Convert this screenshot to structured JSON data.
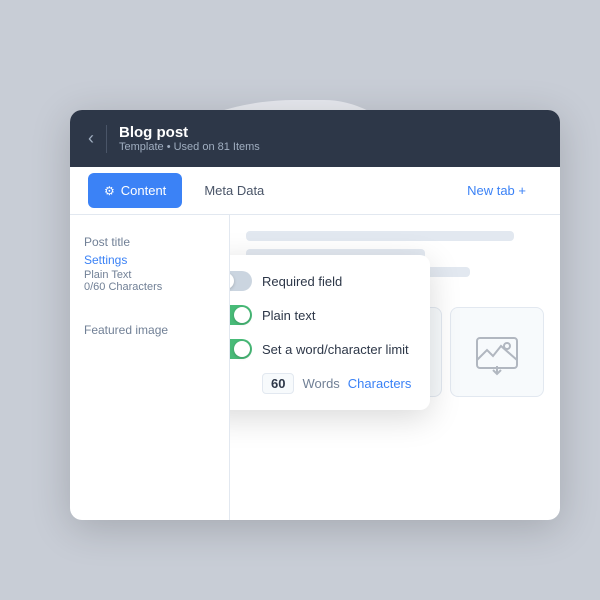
{
  "header": {
    "back_label": "‹",
    "title": "Blog post",
    "subtitle": "Template • Used on 81 Items",
    "divider": true
  },
  "tabs": [
    {
      "id": "content",
      "label": "Content",
      "active": true,
      "icon": "⚙"
    },
    {
      "id": "metadata",
      "label": "Meta Data",
      "active": false
    },
    {
      "id": "newtab",
      "label": "New tab +",
      "active": false
    }
  ],
  "sidebar": {
    "post_title_label": "Post title",
    "settings_link": "Settings",
    "plain_text": "Plain Text",
    "chars_count": "0/60 Characters",
    "featured_image_label": "Featured image"
  },
  "dropdown": {
    "required_field": {
      "label": "Required field",
      "enabled": false
    },
    "plain_text": {
      "label": "Plain text",
      "enabled": true
    },
    "word_limit": {
      "label": "Set a word/character limit",
      "enabled": true
    },
    "limit_value": "60",
    "limit_words": "Words",
    "limit_characters": "Characters"
  },
  "image_cards": [
    {
      "id": 1
    },
    {
      "id": 2
    },
    {
      "id": 3
    }
  ]
}
